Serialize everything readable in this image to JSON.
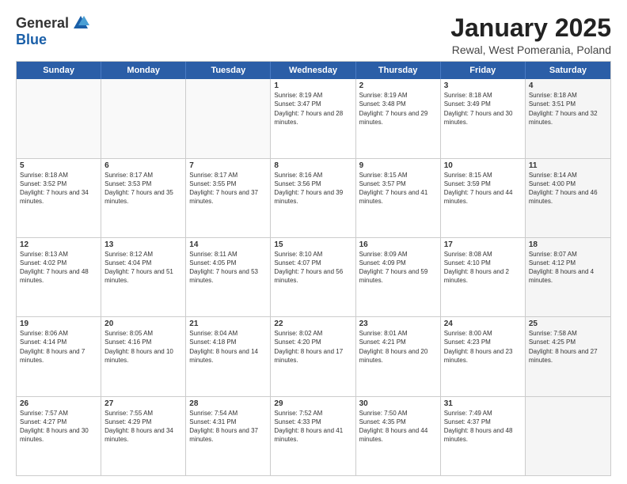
{
  "header": {
    "logo_general": "General",
    "logo_blue": "Blue",
    "title": "January 2025",
    "location": "Rewal, West Pomerania, Poland"
  },
  "day_headers": [
    "Sunday",
    "Monday",
    "Tuesday",
    "Wednesday",
    "Thursday",
    "Friday",
    "Saturday"
  ],
  "weeks": [
    [
      {
        "day": "",
        "empty": true
      },
      {
        "day": "",
        "empty": true
      },
      {
        "day": "",
        "empty": true
      },
      {
        "day": "1",
        "sunrise": "8:19 AM",
        "sunset": "3:47 PM",
        "daylight": "7 hours and 28 minutes."
      },
      {
        "day": "2",
        "sunrise": "8:19 AM",
        "sunset": "3:48 PM",
        "daylight": "7 hours and 29 minutes."
      },
      {
        "day": "3",
        "sunrise": "8:18 AM",
        "sunset": "3:49 PM",
        "daylight": "7 hours and 30 minutes."
      },
      {
        "day": "4",
        "sunrise": "8:18 AM",
        "sunset": "3:51 PM",
        "daylight": "7 hours and 32 minutes.",
        "shaded": true
      }
    ],
    [
      {
        "day": "5",
        "sunrise": "8:18 AM",
        "sunset": "3:52 PM",
        "daylight": "7 hours and 34 minutes."
      },
      {
        "day": "6",
        "sunrise": "8:17 AM",
        "sunset": "3:53 PM",
        "daylight": "7 hours and 35 minutes."
      },
      {
        "day": "7",
        "sunrise": "8:17 AM",
        "sunset": "3:55 PM",
        "daylight": "7 hours and 37 minutes."
      },
      {
        "day": "8",
        "sunrise": "8:16 AM",
        "sunset": "3:56 PM",
        "daylight": "7 hours and 39 minutes."
      },
      {
        "day": "9",
        "sunrise": "8:15 AM",
        "sunset": "3:57 PM",
        "daylight": "7 hours and 41 minutes."
      },
      {
        "day": "10",
        "sunrise": "8:15 AM",
        "sunset": "3:59 PM",
        "daylight": "7 hours and 44 minutes."
      },
      {
        "day": "11",
        "sunrise": "8:14 AM",
        "sunset": "4:00 PM",
        "daylight": "7 hours and 46 minutes.",
        "shaded": true
      }
    ],
    [
      {
        "day": "12",
        "sunrise": "8:13 AM",
        "sunset": "4:02 PM",
        "daylight": "7 hours and 48 minutes."
      },
      {
        "day": "13",
        "sunrise": "8:12 AM",
        "sunset": "4:04 PM",
        "daylight": "7 hours and 51 minutes."
      },
      {
        "day": "14",
        "sunrise": "8:11 AM",
        "sunset": "4:05 PM",
        "daylight": "7 hours and 53 minutes."
      },
      {
        "day": "15",
        "sunrise": "8:10 AM",
        "sunset": "4:07 PM",
        "daylight": "7 hours and 56 minutes."
      },
      {
        "day": "16",
        "sunrise": "8:09 AM",
        "sunset": "4:09 PM",
        "daylight": "7 hours and 59 minutes."
      },
      {
        "day": "17",
        "sunrise": "8:08 AM",
        "sunset": "4:10 PM",
        "daylight": "8 hours and 2 minutes."
      },
      {
        "day": "18",
        "sunrise": "8:07 AM",
        "sunset": "4:12 PM",
        "daylight": "8 hours and 4 minutes.",
        "shaded": true
      }
    ],
    [
      {
        "day": "19",
        "sunrise": "8:06 AM",
        "sunset": "4:14 PM",
        "daylight": "8 hours and 7 minutes."
      },
      {
        "day": "20",
        "sunrise": "8:05 AM",
        "sunset": "4:16 PM",
        "daylight": "8 hours and 10 minutes."
      },
      {
        "day": "21",
        "sunrise": "8:04 AM",
        "sunset": "4:18 PM",
        "daylight": "8 hours and 14 minutes."
      },
      {
        "day": "22",
        "sunrise": "8:02 AM",
        "sunset": "4:20 PM",
        "daylight": "8 hours and 17 minutes."
      },
      {
        "day": "23",
        "sunrise": "8:01 AM",
        "sunset": "4:21 PM",
        "daylight": "8 hours and 20 minutes."
      },
      {
        "day": "24",
        "sunrise": "8:00 AM",
        "sunset": "4:23 PM",
        "daylight": "8 hours and 23 minutes."
      },
      {
        "day": "25",
        "sunrise": "7:58 AM",
        "sunset": "4:25 PM",
        "daylight": "8 hours and 27 minutes.",
        "shaded": true
      }
    ],
    [
      {
        "day": "26",
        "sunrise": "7:57 AM",
        "sunset": "4:27 PM",
        "daylight": "8 hours and 30 minutes."
      },
      {
        "day": "27",
        "sunrise": "7:55 AM",
        "sunset": "4:29 PM",
        "daylight": "8 hours and 34 minutes."
      },
      {
        "day": "28",
        "sunrise": "7:54 AM",
        "sunset": "4:31 PM",
        "daylight": "8 hours and 37 minutes."
      },
      {
        "day": "29",
        "sunrise": "7:52 AM",
        "sunset": "4:33 PM",
        "daylight": "8 hours and 41 minutes."
      },
      {
        "day": "30",
        "sunrise": "7:50 AM",
        "sunset": "4:35 PM",
        "daylight": "8 hours and 44 minutes."
      },
      {
        "day": "31",
        "sunrise": "7:49 AM",
        "sunset": "4:37 PM",
        "daylight": "8 hours and 48 minutes."
      },
      {
        "day": "",
        "empty": true,
        "shaded": true
      }
    ]
  ]
}
